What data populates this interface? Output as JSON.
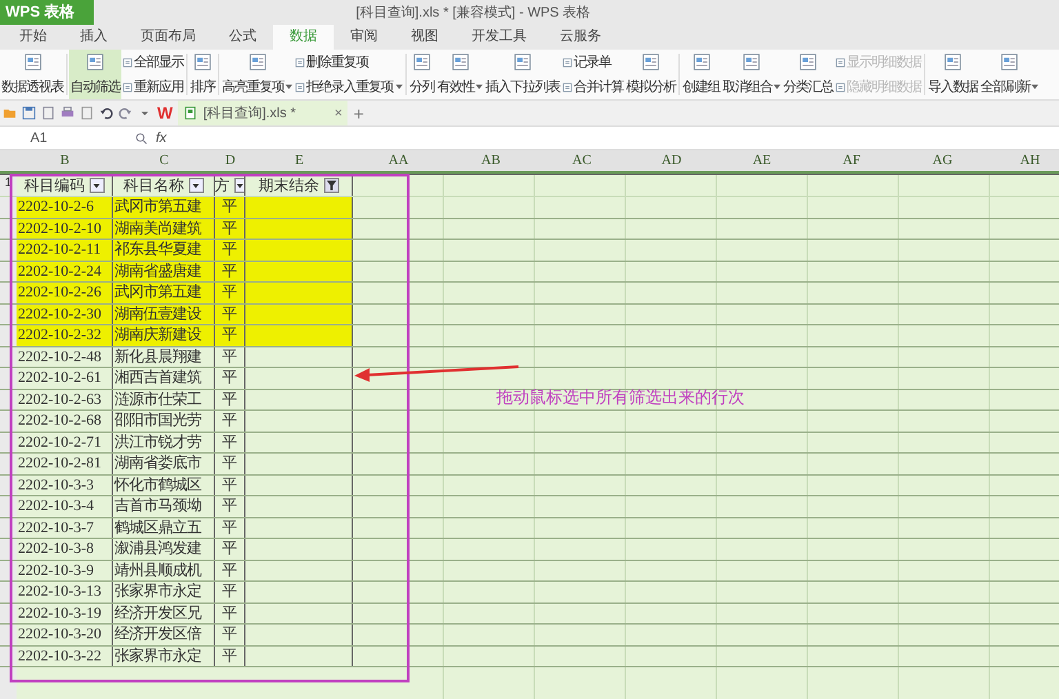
{
  "app": {
    "logo": "WPS 表格",
    "title": "[科目查询].xls * [兼容模式] - WPS 表格"
  },
  "menu": [
    {
      "label": "开始",
      "selected": false
    },
    {
      "label": "插入",
      "selected": false
    },
    {
      "label": "页面布局",
      "selected": false
    },
    {
      "label": "公式",
      "selected": false
    },
    {
      "label": "数据",
      "selected": true
    },
    {
      "label": "审阅",
      "selected": false
    },
    {
      "label": "视图",
      "selected": false
    },
    {
      "label": "开发工具",
      "selected": false
    },
    {
      "label": "云服务",
      "selected": false
    }
  ],
  "ribbon": [
    {
      "kind": "large",
      "label": "数据透视表",
      "selected": false,
      "dropdown": false
    },
    {
      "kind": "separator"
    },
    {
      "kind": "large",
      "label": "自动筛选",
      "selected": true,
      "dropdown": false
    },
    {
      "kind": "stack",
      "items": [
        {
          "label": "全部显示",
          "disabled": false,
          "dropdown": false
        },
        {
          "label": "重新应用",
          "disabled": false,
          "dropdown": false
        }
      ]
    },
    {
      "kind": "separator"
    },
    {
      "kind": "large",
      "label": "排序",
      "selected": false,
      "dropdown": false
    },
    {
      "kind": "separator"
    },
    {
      "kind": "large",
      "label": "高亮重复项",
      "selected": false,
      "dropdown": true
    },
    {
      "kind": "stack",
      "items": [
        {
          "label": "删除重复项",
          "disabled": false,
          "dropdown": false
        },
        {
          "label": "拒绝录入重复项",
          "disabled": false,
          "dropdown": true
        }
      ]
    },
    {
      "kind": "separator"
    },
    {
      "kind": "large",
      "label": "分列",
      "selected": false,
      "dropdown": false
    },
    {
      "kind": "large",
      "label": "有效性",
      "selected": false,
      "dropdown": true
    },
    {
      "kind": "large",
      "label": "插入下拉列表",
      "selected": false,
      "dropdown": false
    },
    {
      "kind": "stack",
      "items": [
        {
          "label": "记录单",
          "disabled": false,
          "dropdown": false
        },
        {
          "label": "合并计算",
          "disabled": false,
          "dropdown": false
        }
      ]
    },
    {
      "kind": "large",
      "label": "模拟分析",
      "selected": false,
      "dropdown": false
    },
    {
      "kind": "separator"
    },
    {
      "kind": "large",
      "label": "创建组",
      "selected": false,
      "dropdown": false
    },
    {
      "kind": "large",
      "label": "取消组合",
      "selected": false,
      "dropdown": true
    },
    {
      "kind": "large",
      "label": "分类汇总",
      "selected": false,
      "dropdown": false
    },
    {
      "kind": "stack",
      "items": [
        {
          "label": "显示明细数据",
          "disabled": true,
          "dropdown": false
        },
        {
          "label": "隐藏明细数据",
          "disabled": true,
          "dropdown": false
        }
      ]
    },
    {
      "kind": "separator"
    },
    {
      "kind": "large",
      "label": "导入数据",
      "selected": false,
      "dropdown": false
    },
    {
      "kind": "large",
      "label": "全部刷新",
      "selected": false,
      "dropdown": true
    }
  ],
  "quickbar": {
    "app_mark": "W",
    "document_tab": "[科目查询].xls *",
    "close": "×",
    "new_tab": "+"
  },
  "formula_bar": {
    "name_box": "A1",
    "fx": "fx"
  },
  "columns": [
    {
      "label": "B"
    },
    {
      "label": "C"
    },
    {
      "label": "D"
    },
    {
      "label": "E"
    },
    {
      "label": "AA"
    },
    {
      "label": "AB"
    },
    {
      "label": "AC"
    },
    {
      "label": "AD"
    },
    {
      "label": "AE"
    },
    {
      "label": "AF"
    },
    {
      "label": "AG"
    },
    {
      "label": "AH"
    }
  ],
  "header_row": {
    "row_number": "1",
    "cells": [
      {
        "label": "科目编码",
        "filtered": false
      },
      {
        "label": "科目名称",
        "filtered": false
      },
      {
        "label": "方",
        "filtered": false
      },
      {
        "label": "期末结余",
        "filtered": true
      }
    ]
  },
  "rows": [
    {
      "code": "2202-10-2-6",
      "name": "武冈市第五建",
      "direction": "平",
      "highlighted": true
    },
    {
      "code": "2202-10-2-10",
      "name": "湖南美尚建筑",
      "direction": "平",
      "highlighted": true
    },
    {
      "code": "2202-10-2-11",
      "name": "祁东县华夏建",
      "direction": "平",
      "highlighted": true
    },
    {
      "code": "2202-10-2-24",
      "name": "湖南省盛唐建",
      "direction": "平",
      "highlighted": true
    },
    {
      "code": "2202-10-2-26",
      "name": "武冈市第五建",
      "direction": "平",
      "highlighted": true
    },
    {
      "code": "2202-10-2-30",
      "name": "湖南伍壹建设",
      "direction": "平",
      "highlighted": true
    },
    {
      "code": "2202-10-2-32",
      "name": "湖南庆新建设",
      "direction": "平",
      "highlighted": true
    },
    {
      "code": "2202-10-2-48",
      "name": "新化县晨翔建",
      "direction": "平",
      "highlighted": false
    },
    {
      "code": "2202-10-2-61",
      "name": "湘西吉首建筑",
      "direction": "平",
      "highlighted": false
    },
    {
      "code": "2202-10-2-63",
      "name": "涟源市仕荣工",
      "direction": "平",
      "highlighted": false
    },
    {
      "code": "2202-10-2-68",
      "name": "邵阳市国光劳",
      "direction": "平",
      "highlighted": false
    },
    {
      "code": "2202-10-2-71",
      "name": "洪江市锐才劳",
      "direction": "平",
      "highlighted": false
    },
    {
      "code": "2202-10-2-81",
      "name": "湖南省娄底市",
      "direction": "平",
      "highlighted": false
    },
    {
      "code": "2202-10-3-3",
      "name": "怀化市鹤城区",
      "direction": "平",
      "highlighted": false
    },
    {
      "code": "2202-10-3-4",
      "name": "吉首市马颈坳",
      "direction": "平",
      "highlighted": false
    },
    {
      "code": "2202-10-3-7",
      "name": "鹤城区鼎立五",
      "direction": "平",
      "highlighted": false
    },
    {
      "code": "2202-10-3-8",
      "name": "溆浦县鸿发建",
      "direction": "平",
      "highlighted": false
    },
    {
      "code": "2202-10-3-9",
      "name": "靖州县顺成机",
      "direction": "平",
      "highlighted": false
    },
    {
      "code": "2202-10-3-13",
      "name": "张家界市永定",
      "direction": "平",
      "highlighted": false
    },
    {
      "code": "2202-10-3-19",
      "name": "经济开发区兄",
      "direction": "平",
      "highlighted": false
    },
    {
      "code": "2202-10-3-20",
      "name": "经济开发区倍",
      "direction": "平",
      "highlighted": false
    },
    {
      "code": "2202-10-3-22",
      "name": "张家界市永定",
      "direction": "平",
      "highlighted": false
    }
  ],
  "annotation": {
    "text": "拖动鼠标选中所有筛选出来的行次"
  }
}
